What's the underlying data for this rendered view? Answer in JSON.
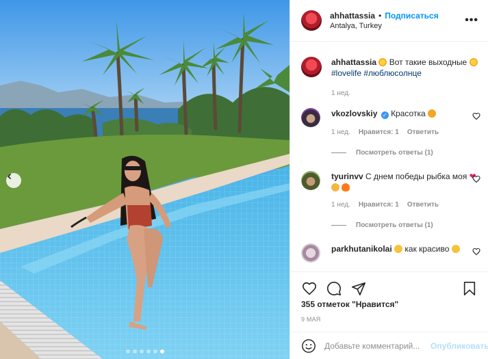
{
  "post": {
    "username": "ahhattassia",
    "follow_label": "Подписаться",
    "location": "Antalya, Turkey",
    "more_label": "•••"
  },
  "caption": {
    "username": "ahhattassia",
    "text_1": "Вот такие выходные",
    "hashtag_1": "#lovelife",
    "hashtag_2": "#люблюсолнце",
    "time": "1 нед."
  },
  "comments": [
    {
      "username": "vkozlovskiy",
      "text": "Красотка",
      "time": "1 нед.",
      "likes": "Нравится: 1",
      "reply": "Ответить",
      "view_replies": "Посмотреть ответы (1)"
    },
    {
      "username": "tyurinvv",
      "text": "С днем победы рыбка моя",
      "time": "1 нед.",
      "likes": "Нравится: 1",
      "reply": "Ответить",
      "view_replies": "Посмотреть ответы (1)"
    },
    {
      "username": "parkhutanikolai",
      "text": "как  красиво"
    }
  ],
  "likes_text": "355 отметок \"Нравится\"",
  "date_text": "9 МАЯ",
  "add_comment": {
    "placeholder": "Добавьте комментарий...",
    "publish_label": "Опубликовать"
  },
  "colors": {
    "accent": "#0095f6",
    "link": "#00376b",
    "muted": "#8e8e8e",
    "publish_disabled": "#b2dffc"
  }
}
